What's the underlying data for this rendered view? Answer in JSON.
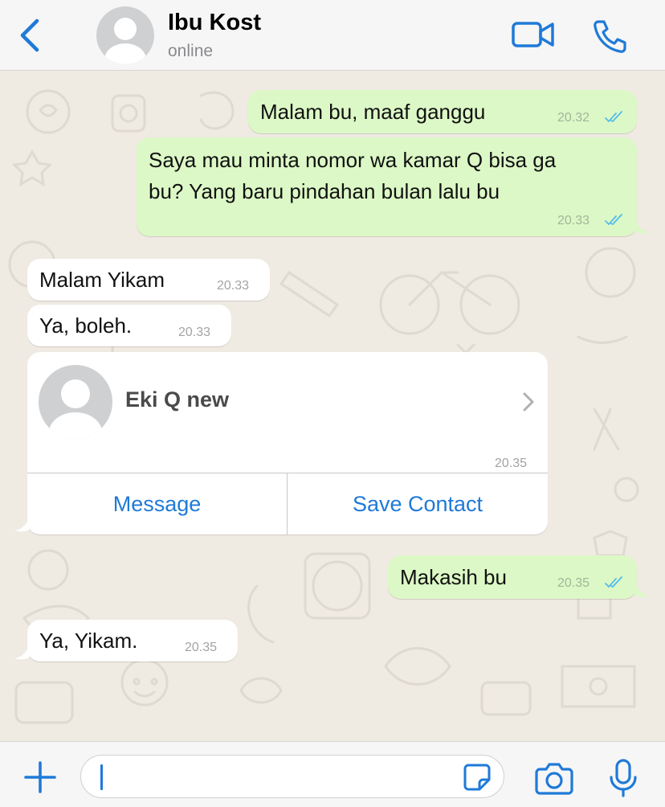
{
  "header": {
    "contact_name": "Ibu Kost",
    "status": "online",
    "back_icon": "chevron-left-icon",
    "video_icon": "video-camera-icon",
    "call_icon": "phone-icon",
    "accent_color": "#1f7ad8"
  },
  "messages": [
    {
      "direction": "out",
      "text": "Malam bu, maaf ganggu",
      "time": "20.32",
      "read": true
    },
    {
      "direction": "out",
      "lines": [
        "Saya mau minta nomor wa kamar Q bisa ga",
        "bu? Yang baru pindahan bulan lalu bu"
      ],
      "time": "20.33",
      "read": true
    },
    {
      "direction": "in",
      "text": "Malam Yikam",
      "time": "20.33"
    },
    {
      "direction": "in",
      "text": "Ya, boleh.",
      "time": "20.33"
    },
    {
      "direction": "out",
      "text": "Makasih bu",
      "time": "20.35",
      "read": true
    },
    {
      "direction": "in",
      "text": "Ya, Yikam.",
      "time": "20.35"
    }
  ],
  "contact_card": {
    "name": "Eki Q new",
    "time": "20.35",
    "message_label": "Message",
    "save_label": "Save Contact"
  },
  "composer": {
    "placeholder": "",
    "value": "",
    "plus_icon": "plus-icon",
    "sticker_icon": "sticker-icon",
    "camera_icon": "camera-icon",
    "mic_icon": "microphone-icon"
  },
  "colors": {
    "outgoing_bubble": "#dcf8c6",
    "incoming_bubble": "#ffffff",
    "chat_background": "#efeae2",
    "read_ticks": "#53bdeb"
  }
}
